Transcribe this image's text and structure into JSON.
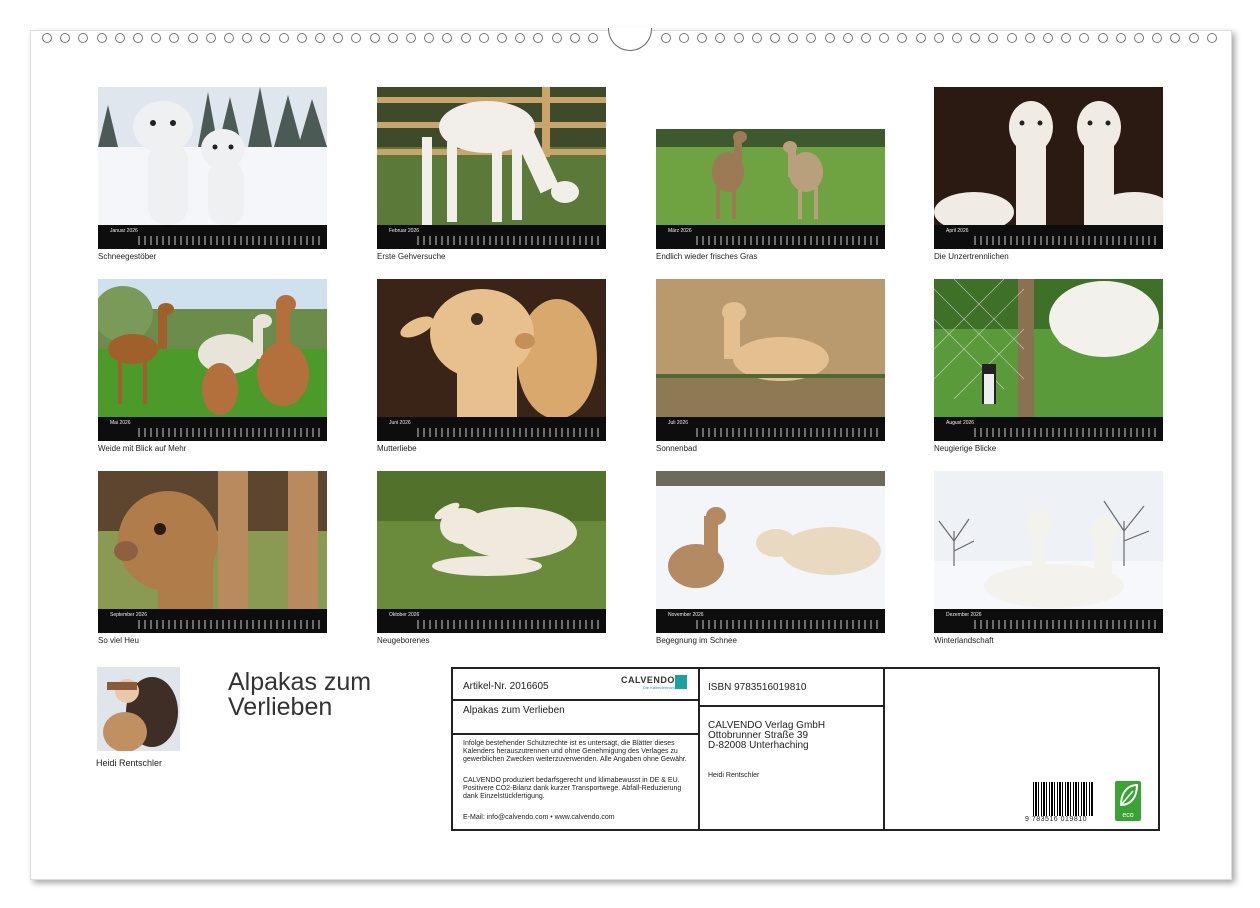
{
  "months": [
    {
      "month": "Januar 2026",
      "caption": "Schneegestöber"
    },
    {
      "month": "Februar 2026",
      "caption": "Erste Gehversuche"
    },
    {
      "month": "März 2026",
      "caption": "Endlich wieder frisches Gras"
    },
    {
      "month": "April 2026",
      "caption": "Die Unzertrennlichen"
    },
    {
      "month": "Mai 2026",
      "caption": "Weide mit Blick auf Mehr"
    },
    {
      "month": "Juni 2026",
      "caption": "Mutterliebe"
    },
    {
      "month": "Juli 2026",
      "caption": "Sonnenbad"
    },
    {
      "month": "August 2026",
      "caption": "Neugierige Blicke"
    },
    {
      "month": "September 2026",
      "caption": "So viel Heu"
    },
    {
      "month": "Oktober 2026",
      "caption": "Neugeborenes"
    },
    {
      "month": "November 2026",
      "caption": "Begegnung im Schnee"
    },
    {
      "month": "Dezember 2026",
      "caption": "Winterlandschaft"
    }
  ],
  "title": {
    "line1": "Alpakas zum",
    "line2": "Verlieben"
  },
  "author": "Heidi Rentschler",
  "info": {
    "artikel": "Artikel-Nr. 2016605",
    "logo_text": "CALVENDO",
    "logo_sub": "Die Kalendermarke",
    "product_title": "Alpakas zum Verlieben",
    "legal": "Infolge bestehender Schutzrechte ist es untersagt, die Blätter dieses Kalenders herauszutrennen und ohne Genehmigung des Verlages zu gewerblichen Zwecken weiterzuverwenden. Alle Angaben ohne Gewähr.",
    "eco_text": "CALVENDO produziert bedarfsgerecht und klimabewusst in DE & EU. Positivere CO2-Bilanz dank kurzer Transportwege. Abfall-Reduzierung dank Einzelstückfertigung.",
    "contact": "E-Mail: info@calvendo.com • www.calvendo.com",
    "isbn": "ISBN 9783516019810",
    "publisher_1": "CALVENDO Verlag GmbH",
    "publisher_2": "Ottobrunner Straße 39",
    "publisher_3": "D-82008 Unterhaching",
    "author_small": "Heidi Rentschler",
    "barcode_number": "9 783516 019810",
    "eco_badge": "eco"
  },
  "colors": {
    "bar": "#0d0d0d",
    "eco": "#3aa335",
    "logo": "#1aa1a0"
  }
}
